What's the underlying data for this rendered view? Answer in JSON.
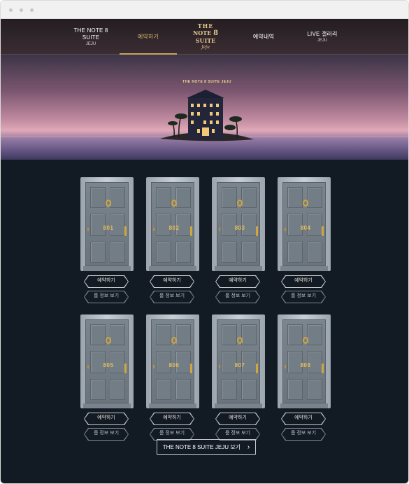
{
  "nav": {
    "items": [
      {
        "line1": "THE NOTE 8 SUITE",
        "line2": "JEJU"
      },
      {
        "line1": "예약하기",
        "line2": ""
      },
      {
        "line1": "예약내역",
        "line2": ""
      },
      {
        "line1": "LIVE 갤러리",
        "line2": "JEJU"
      }
    ],
    "logo": {
      "line1": "THE",
      "line2_a": "NOTE",
      "line2_b": "8",
      "line2_c": "SUITE",
      "line3": "Jeju"
    }
  },
  "hero": {
    "title": "THE NOTE 8 SUITE JEJU"
  },
  "rooms": [
    {
      "number": "801",
      "reserve": "예약하기",
      "info": "룸 정보 보기"
    },
    {
      "number": "802",
      "reserve": "예약하기",
      "info": "룸 정보 보기"
    },
    {
      "number": "803",
      "reserve": "예약하기",
      "info": "룸 정보 보기"
    },
    {
      "number": "804",
      "reserve": "예약하기",
      "info": "룸 정보 보기"
    },
    {
      "number": "805",
      "reserve": "예약하기",
      "info": "룸 정보 보기"
    },
    {
      "number": "806",
      "reserve": "예약하기",
      "info": "룸 정보 보기"
    },
    {
      "number": "807",
      "reserve": "예약하기",
      "info": "룸 정보 보기"
    },
    {
      "number": "808",
      "reserve": "예약하기",
      "info": "룸 정보 보기"
    }
  ],
  "footer": {
    "button_label": "THE NOTE 8 SUITE JEJU 보기"
  },
  "colors": {
    "accent": "#c9a45c",
    "background": "#121a24",
    "door": "#727c84"
  }
}
